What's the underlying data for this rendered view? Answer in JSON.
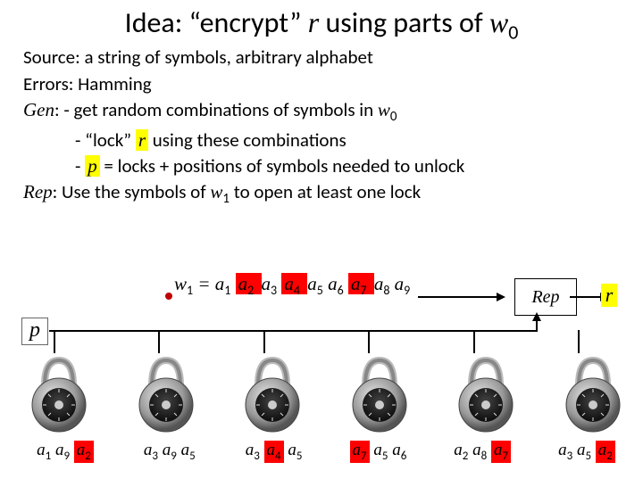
{
  "title": {
    "pre": "Idea: “encrypt” ",
    "r": "r",
    "mid": " using parts of ",
    "w": "w",
    "sub0": "0"
  },
  "source": {
    "label": "Source:",
    "text": " a string of symbols, arbitrary alphabet"
  },
  "errors": {
    "label": "Errors:",
    "text": " Hamming"
  },
  "gen_label": "Gen",
  "gen1_pre": ": - get random combinations of symbols in ",
  "gen1_w": "w",
  "gen1_sub": "0",
  "gen2_pre": "- “lock” ",
  "gen2_r": "r",
  "gen2_post": "  using these combinations",
  "gen3_pre": "-  ",
  "gen3_p": "p",
  "gen3_post": "  = locks + positions of symbols needed to unlock",
  "rep_label": "Rep",
  "rep_text_pre": ":  Use the symbols of ",
  "rep_w": "w",
  "rep_sub": "1",
  "rep_text_post": " to open at least one lock",
  "rep_box": "Rep",
  "r_output": "r",
  "p_label": "p",
  "w1": {
    "lhs_w": "w",
    "lhs_sub": "1",
    "eq": " = ",
    "tokens": [
      {
        "a": "a",
        "s": "1",
        "hl": ""
      },
      {
        "a": "a",
        "s": "2",
        "hl": "red"
      },
      {
        "a": "a",
        "s": "3",
        "hl": ""
      },
      {
        "a": "a",
        "s": "4",
        "hl": "red"
      },
      {
        "a": "a",
        "s": "5",
        "hl": ""
      },
      {
        "a": "a",
        "s": "6",
        "hl": ""
      },
      {
        "a": "a",
        "s": "7",
        "hl": "red"
      },
      {
        "a": "a",
        "s": "8",
        "hl": ""
      },
      {
        "a": "a",
        "s": "9",
        "hl": ""
      }
    ]
  },
  "locks": [
    [
      {
        "a": "a",
        "s": "1",
        "hl": ""
      },
      {
        "a": "a",
        "s": "9",
        "hl": ""
      },
      {
        "a": "a",
        "s": "2",
        "hl": "red"
      }
    ],
    [
      {
        "a": "a",
        "s": "3",
        "hl": ""
      },
      {
        "a": "a",
        "s": "9",
        "hl": ""
      },
      {
        "a": "a",
        "s": "5",
        "hl": ""
      }
    ],
    [
      {
        "a": "a",
        "s": "3",
        "hl": ""
      },
      {
        "a": "a",
        "s": "4",
        "hl": "red"
      },
      {
        "a": "a",
        "s": "5",
        "hl": ""
      }
    ],
    [
      {
        "a": "a",
        "s": "7",
        "hl": "red"
      },
      {
        "a": "a",
        "s": "5",
        "hl": ""
      },
      {
        "a": "a",
        "s": "6",
        "hl": ""
      }
    ],
    [
      {
        "a": "a",
        "s": "2",
        "hl": ""
      },
      {
        "a": "a",
        "s": "8",
        "hl": ""
      },
      {
        "a": "a",
        "s": "7",
        "hl": "red"
      }
    ],
    [
      {
        "a": "a",
        "s": "3",
        "hl": ""
      },
      {
        "a": "a",
        "s": "5",
        "hl": ""
      },
      {
        "a": "a",
        "s": "2",
        "hl": "red"
      }
    ]
  ]
}
